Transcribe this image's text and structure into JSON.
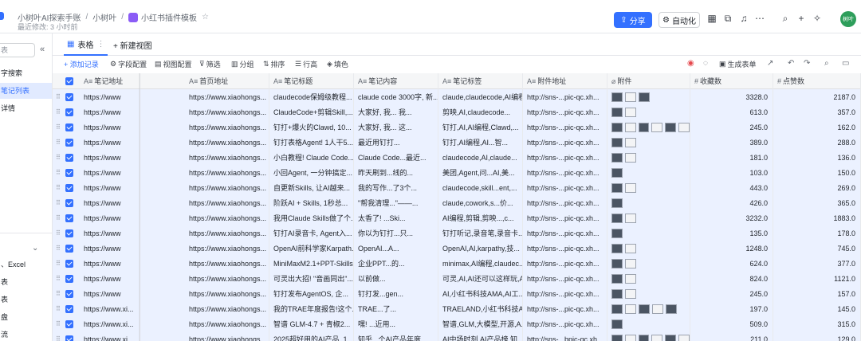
{
  "breadcrumb": [
    "小树叶AI探索手账",
    "小树叶",
    "小红书插件模板"
  ],
  "modified": "最近修改: 3 小时前",
  "header": {
    "share": "分享",
    "automation": "自动化",
    "avatar_text": "树叶"
  },
  "sidebar": {
    "search_placeholder": "表",
    "items": [
      {
        "label": "字搜索",
        "active": false
      },
      {
        "label": "笔记列表",
        "active": true
      },
      {
        "label": "详情",
        "active": false
      },
      {
        "label": "、Excel",
        "active": false
      },
      {
        "label": "表",
        "active": false
      },
      {
        "label": "表",
        "active": false
      },
      {
        "label": "盘",
        "active": false
      },
      {
        "label": "流",
        "active": false
      }
    ]
  },
  "views": {
    "table": "表格",
    "new_view": "+ 新建视图"
  },
  "toolbar": {
    "add_record": "+ 添加记录",
    "field_config": "字段配置",
    "view_config": "视图配置",
    "filter": "筛选",
    "group": "分组",
    "sort": "排序",
    "row_height": "行高",
    "fill": "填色",
    "generate_form": "生成表单"
  },
  "columns": [
    "笔记地址",
    "首页地址",
    "笔记标题",
    "笔记内容",
    "笔记标签",
    "附件地址",
    "附件",
    "收藏数",
    "点赞数"
  ],
  "rows": [
    {
      "url": "https://www",
      "home": "https://www.xiaohongs...",
      "title": "claudecode保姆级教程...",
      "content": "claude code 3000字, 新...",
      "tags": "claude,claudecode,AI编程",
      "attach": "http://sns-...pic-qc.xh...",
      "thumbs": 3,
      "fav": "3328.0",
      "like": "2187.0"
    },
    {
      "url": "https://www",
      "home": "https://www.xiaohongs...",
      "title": "ClaudeCode+剪辑Skill,...",
      "content": "大家好, 我... 我...",
      "tags": "剪映,AI,claudecode...",
      "attach": "http://sns-...pic-qc.xh...",
      "thumbs": 2,
      "fav": "613.0",
      "like": "357.0"
    },
    {
      "url": "https://www",
      "home": "https://www.xiaohongs...",
      "title": "钉打+爆火的Clawd, 10...",
      "content": "大家好, 我... 这...",
      "tags": "钉打,AI,AI编程,Clawd,...",
      "attach": "http://sns-...pic-qc.xh...",
      "thumbs": 6,
      "fav": "245.0",
      "like": "162.0"
    },
    {
      "url": "https://www",
      "home": "https://www.xiaohongs...",
      "title": "钉打表格Agent! 1人干5...",
      "content": "最近用钉打...",
      "tags": "钉打,AI编程,AI...智...",
      "attach": "http://sns-...pic-qc.xh...",
      "thumbs": 2,
      "fav": "389.0",
      "like": "288.0"
    },
    {
      "url": "https://www",
      "home": "https://www.xiaohongs...",
      "title": "小白教程! Claude Code...",
      "content": "Claude Code...最近...",
      "tags": "claudecode,AI,claude...",
      "attach": "http://sns-...pic-qc.xh...",
      "thumbs": 2,
      "fav": "181.0",
      "like": "136.0"
    },
    {
      "url": "https://www",
      "home": "https://www.xiaohongs...",
      "title": "小回Agent, 一分钟搞定...",
      "content": "昨天刷到...线的...",
      "tags": "美团,Agent,问...AI,美...",
      "attach": "http://sns-...pic-qc.xh...",
      "thumbs": 1,
      "fav": "103.0",
      "like": "150.0"
    },
    {
      "url": "https://www",
      "home": "https://www.xiaohongs...",
      "title": "自更新Skills, 让AI越来...",
      "content": "我的写作...了3个...",
      "tags": "claudecode,skill...ent,...",
      "attach": "http://sns-...pic-qc.xh...",
      "thumbs": 2,
      "fav": "443.0",
      "like": "269.0"
    },
    {
      "url": "https://www",
      "home": "https://www.xiaohongs...",
      "title": "阶跃AI + Skills, 1秒总...",
      "content": "\"帮我清理...\"——...",
      "tags": "claude,cowork,s...价...",
      "attach": "http://sns-...pic-qc.xh...",
      "thumbs": 1,
      "fav": "426.0",
      "like": "365.0"
    },
    {
      "url": "https://www",
      "home": "https://www.xiaohongs...",
      "title": "我用Claude Skills做了个...",
      "content": "太香了! ...Ski...",
      "tags": "AI编程,剪辑,剪映...,c...",
      "attach": "http://sns-...pic-qc.xh...",
      "thumbs": 2,
      "fav": "3232.0",
      "like": "1883.0"
    },
    {
      "url": "https://www",
      "home": "https://www.xiaohongs...",
      "title": "钉打AI录音卡, Agent入...",
      "content": "你以为钉打...只...",
      "tags": "钉打听记,录音笔,录音卡...",
      "attach": "http://sns-...pic-qc.xh...",
      "thumbs": 1,
      "fav": "135.0",
      "like": "178.0"
    },
    {
      "url": "https://www",
      "home": "https://www.xiaohongs...",
      "title": "OpenAI前科学家Karpath...",
      "content": "OpenAI...A...",
      "tags": "OpenAI,AI,karpathy,技...",
      "attach": "http://sns-...pic-qc.xh...",
      "thumbs": 2,
      "fav": "1248.0",
      "like": "745.0"
    },
    {
      "url": "https://www",
      "home": "https://www.xiaohongs...",
      "title": "MiniMaxM2.1+PPT-Skills...",
      "content": "企业PPT...的...",
      "tags": "minimax,AI编程,claudec...",
      "attach": "http://sns-...pic-qc.xh...",
      "thumbs": 2,
      "fav": "624.0",
      "like": "377.0"
    },
    {
      "url": "https://www",
      "home": "https://www.xiaohongs...",
      "title": "可灵出大招! \"音画同出\"...",
      "content": "以前做...",
      "tags": "可灵,AI,AI还可以这样玩,AI...",
      "attach": "http://sns-...pic-qc.xh...",
      "thumbs": 2,
      "fav": "824.0",
      "like": "1121.0"
    },
    {
      "url": "https://www",
      "home": "https://www.xiaohongs...",
      "title": "钉打发布AgentOS, 企...",
      "content": "钉打发...gen...",
      "tags": "AI,小红书科技AMA,AI工...",
      "attach": "http://sns-...pic-qc.xh...",
      "thumbs": 2,
      "fav": "245.0",
      "like": "157.0"
    },
    {
      "url": "https://www.xi...",
      "home": "https://www.xiaohongs...",
      "title": "我的TRAE年度报告!这个...",
      "content": "TRAE...了...",
      "tags": "TRAELAND,小红书科技AM...",
      "attach": "http://sns-...pic-qc.xh...",
      "thumbs": 5,
      "fav": "197.0",
      "like": "145.0"
    },
    {
      "url": "https://www.xi...",
      "home": "https://www.xiaohongs...",
      "title": "智谱 GLM-4.7 + 青椒2...",
      "content": "嘿! ...近用...",
      "tags": "智谱,GLM,大模型,开源,A...",
      "attach": "http://sns-...pic-qc.xh...",
      "thumbs": 1,
      "fav": "509.0",
      "like": "315.0"
    },
    {
      "url": "https://www.xi...",
      "home": "https://www.xiaohongs...",
      "title": "2025超好用的AI产品, 1...",
      "content": "知乎...个AI产品年度...",
      "tags": "AI中场时刻,AI产品榜,知...",
      "attach": "http://sns-...bpic-qc.xh...",
      "thumbs": 6,
      "fav": "211.0",
      "like": "129.0"
    }
  ]
}
